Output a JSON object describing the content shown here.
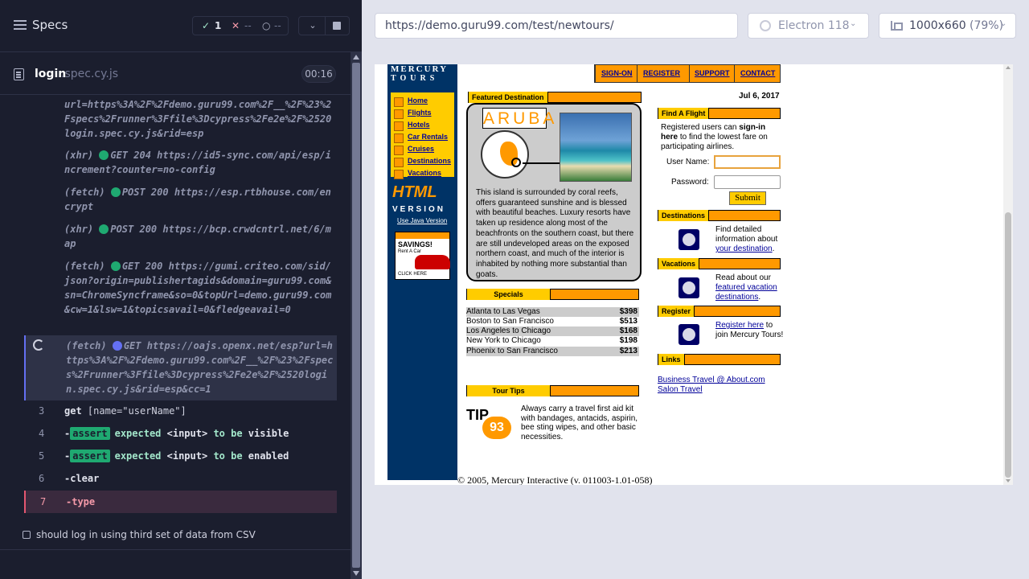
{
  "specs_panel": {
    "title": "Specs",
    "stats": {
      "passed_icon": "✓",
      "passed": "1",
      "failed_icon": "✕",
      "failed": "--",
      "pending_icon": "○",
      "pending": "--"
    },
    "spec_file_name": "login",
    "spec_file_ext": ".spec.cy.js",
    "timer": "00:16"
  },
  "command_log": {
    "entries": [
      {
        "kind": "xhr-tail",
        "text": "url=https%3A%2F%2Fdemo.guru99.com%2F__%2F%23%2Fspecs%2Frunner%3Ffile%3Dcypress%2Fe2e%2F%2520login.spec.cy.js&rid=esp"
      },
      {
        "kind": "(xhr)",
        "text": "GET 204 https://id5-sync.com/api/esp/increment?counter=no-config"
      },
      {
        "kind": "(fetch)",
        "text": "POST 200 https://esp.rtbhouse.com/encrypt"
      },
      {
        "kind": "(xhr)",
        "text": "POST 200 https://bcp.crwdcntrl.net/6/map"
      },
      {
        "kind": "(fetch)",
        "text": "GET 200 https://gumi.criteo.com/sid/json?origin=publishertagids&domain=guru99.com&sn=ChromeSyncframe&so=0&topUrl=demo.guru99.com&cw=1&lsw=1&topicsavail=0&fledgeavail=0"
      },
      {
        "kind": "(fetch)",
        "text": "GET https://oajs.openx.net/esp?url=https%3A%2F%2Fdemo.guru99.com%2F__%2F%23%2Fspecs%2Frunner%3Ffile%3Dcypress%2Fe2e%2F%2520login.spec.cy.js&rid=esp&cc=1"
      }
    ],
    "steps": [
      {
        "num": "3",
        "cmd": "get",
        "arg": "[name=\"userName\"]"
      },
      {
        "num": "4",
        "cmd": "-assert",
        "badge": "assert",
        "expected": "expected",
        "subject": "<input>",
        "to_be": "to be",
        "what": "visible"
      },
      {
        "num": "5",
        "cmd": "-assert",
        "badge": "assert",
        "expected": "expected",
        "subject": "<input>",
        "to_be": "to be",
        "what": "enabled"
      },
      {
        "num": "6",
        "cmd": "-clear"
      },
      {
        "num": "7",
        "cmd": "-type"
      }
    ],
    "test_title": "should log in using third set of data from CSV"
  },
  "browser_bar": {
    "url": "https://demo.guru99.com/test/newtours/",
    "browser": "Electron 118",
    "viewport": "1000x660",
    "zoom": "(79%)"
  },
  "aut": {
    "logo_line1": "MERCURY",
    "logo_line2": "TOURS",
    "top_nav": [
      "SIGN-ON",
      "REGISTER",
      "SUPPORT",
      "CONTACT"
    ],
    "side_nav": [
      "Home",
      "Flights",
      "Hotels",
      "Car Rentals",
      "Cruises",
      "Destinations",
      "Vacations"
    ],
    "html_version": "HTML",
    "html_version_sub": "VERSION",
    "java_link": "Use Java Version",
    "savings": "SAVINGS!",
    "savings_sub": "Rent A Car",
    "savings_click": "CLICK HERE",
    "date": "Jul 6, 2017",
    "featured_header": "Featured Destination",
    "featured_name": "ARUBA",
    "featured_text": "This island is surrounded by coral reefs, offers guaranteed sunshine and is blessed with beautiful beaches. Luxury resorts have taken up residence along most of the beachfronts on the southern coast, but there are still undeveloped areas on the exposed northern coast, and much of the interior is inhabited by nothing more substantial than goats.",
    "specials_header": "Specials",
    "specials": [
      {
        "route": "Atlanta to Las Vegas",
        "price": "$398"
      },
      {
        "route": "Boston to San Francisco",
        "price": "$513"
      },
      {
        "route": "Los Angeles to Chicago",
        "price": "$168"
      },
      {
        "route": "New York to Chicago",
        "price": "$198"
      },
      {
        "route": "Phoenix to San Francisco",
        "price": "$213"
      }
    ],
    "tour_tips_header": "Tour Tips",
    "tip_label": "TIP",
    "tip_num": "93",
    "tip_text": "Always carry a travel first aid kit with bandages, antacids, aspirin, bee sting wipes, and other basic necessities.",
    "footer": "© 2005, Mercury Interactive (v. 011003-1.01-058)",
    "find_flight_header": "Find A Flight",
    "find_flight_text_1": "Registered users can ",
    "find_flight_text_bold": "sign-in here",
    "find_flight_text_2": " to find the lowest fare on participating airlines.",
    "user_name_label": "User Name:",
    "password_label": "Password:",
    "submit": "Submit",
    "destinations_header": "Destinations",
    "destinations_text": "Find detailed information about ",
    "destinations_link": "your destination",
    "vacations_header": "Vacations",
    "vacations_text": "Read about our ",
    "vacations_link": "featured vacation destinations",
    "register_header": "Register",
    "register_link": "Register here",
    "register_text": " to join Mercury Tours!",
    "links_header": "Links",
    "links": [
      "Business Travel @ About.com",
      "Salon Travel"
    ]
  }
}
